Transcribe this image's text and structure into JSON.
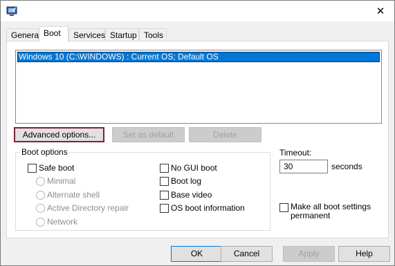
{
  "window": {
    "close_glyph": "✕"
  },
  "tabs": [
    {
      "label": "General"
    },
    {
      "label": "Boot"
    },
    {
      "label": "Services"
    },
    {
      "label": "Startup"
    },
    {
      "label": "Tools"
    }
  ],
  "boot_list": {
    "items": [
      "Windows 10 (C:\\WINDOWS) : Current OS; Default OS"
    ]
  },
  "list_buttons": {
    "advanced": "Advanced options...",
    "set_default": "Set as default",
    "delete": "Delete"
  },
  "boot_options": {
    "title": "Boot options",
    "safe_boot": "Safe boot",
    "minimal": "Minimal",
    "alternate_shell": "Alternate shell",
    "active_directory_repair": "Active Directory repair",
    "network": "Network",
    "no_gui_boot": "No GUI boot",
    "boot_log": "Boot log",
    "base_video": "Base video",
    "os_boot_information": "OS boot information"
  },
  "timeout": {
    "label": "Timeout:",
    "value": "30",
    "unit": "seconds"
  },
  "permanent": {
    "label_line1": "Make all boot settings",
    "label_line2": "permanent"
  },
  "footer": {
    "ok": "OK",
    "cancel": "Cancel",
    "apply": "Apply",
    "help": "Help"
  },
  "colors": {
    "selection": "#0078d7",
    "focus_border": "#7b2233"
  }
}
